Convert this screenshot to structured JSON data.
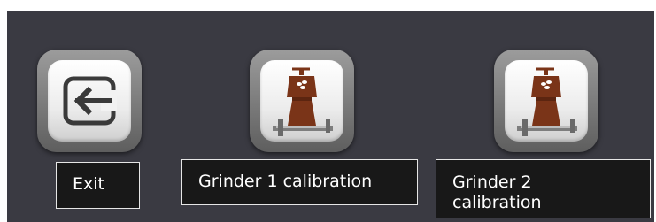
{
  "buttons": [
    {
      "label": "Exit",
      "icon": "exit-icon"
    },
    {
      "label": "Grinder 1 calibration",
      "icon": "grinder-calibration-icon"
    },
    {
      "label": "Grinder 2\ncalibration",
      "icon": "grinder-calibration-icon"
    }
  ],
  "colors": {
    "background": "#3a3a42",
    "label_background": "#181818",
    "label_text": "#ffffff",
    "grinder_brown": "#7a3418"
  }
}
